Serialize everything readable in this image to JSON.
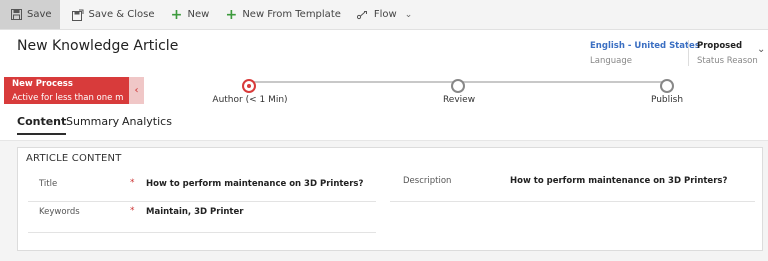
{
  "command_bar": {
    "items": [
      {
        "label": "Save",
        "icon": "save-icon"
      },
      {
        "label": "Save & Close",
        "icon": "save-close-icon"
      },
      {
        "label": "New",
        "icon": "plus-icon"
      },
      {
        "label": "New From Template",
        "icon": "plus-icon"
      },
      {
        "label": "Flow",
        "icon": "flow-icon"
      }
    ]
  },
  "header": {
    "title": "New Knowledge Article",
    "language_value": "English - United States",
    "language_label": "Language",
    "status_value": "Proposed",
    "status_label": "Status Reason"
  },
  "process": {
    "name": "New Process",
    "sub": "Active for less than one mi...",
    "stages": [
      {
        "label": "Author  (< 1 Min)",
        "active": true
      },
      {
        "label": "Review",
        "active": false
      },
      {
        "label": "Publish",
        "active": false
      }
    ]
  },
  "tabs": [
    {
      "label": "Content",
      "active": true
    },
    {
      "label": "Summary",
      "active": false
    },
    {
      "label": "Analytics",
      "active": false
    }
  ],
  "section": {
    "title": "ARTICLE CONTENT",
    "fields": {
      "title_label": "Title",
      "title_value": "How to perform maintenance on 3D Printers?",
      "keywords_label": "Keywords",
      "keywords_value": "Maintain, 3D Printer",
      "description_label": "Description",
      "description_value": "How to perform maintenance on 3D Printers?",
      "required_marker": "*"
    }
  },
  "colors": {
    "accent_red": "#d83b3b",
    "link_blue": "#3b6fc2",
    "add_green": "#3c9a3c"
  }
}
